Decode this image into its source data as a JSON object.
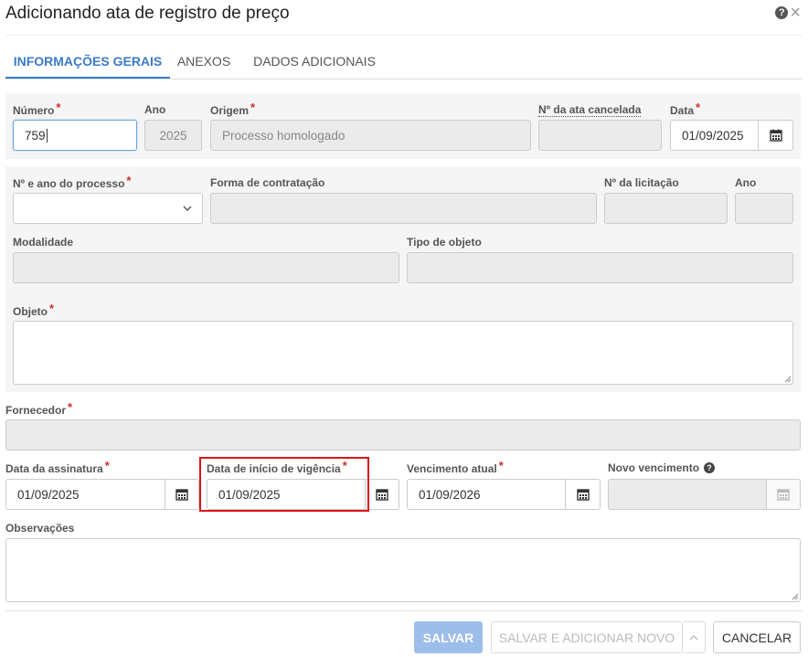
{
  "dialog": {
    "title": "Adicionando ata de registro de preço"
  },
  "tabs": [
    {
      "label": "INFORMAÇÕES GERAIS",
      "active": true
    },
    {
      "label": "ANEXOS",
      "active": false
    },
    {
      "label": "DADOS ADICIONAIS",
      "active": false
    }
  ],
  "required_mark": "*",
  "section1": {
    "numero": {
      "label": "Número",
      "value": "759"
    },
    "ano": {
      "label": "Ano",
      "value": "2025"
    },
    "origem": {
      "label": "Origem",
      "value": "Processo homologado"
    },
    "ata_cancelada": {
      "label": "Nº da ata cancelada",
      "value": ""
    },
    "data": {
      "label": "Data",
      "value": "01/09/2025"
    }
  },
  "section2": {
    "processo": {
      "label": "Nº e ano do processo",
      "value": ""
    },
    "forma": {
      "label": "Forma de contratação",
      "value": ""
    },
    "licitacao": {
      "label": "Nº da licitação",
      "value": ""
    },
    "ano": {
      "label": "Ano",
      "value": ""
    },
    "modalidade": {
      "label": "Modalidade",
      "value": ""
    },
    "tipo_objeto": {
      "label": "Tipo de objeto",
      "value": ""
    },
    "objeto": {
      "label": "Objeto",
      "value": ""
    }
  },
  "fornecedor": {
    "label": "Fornecedor",
    "value": ""
  },
  "dates": {
    "assinatura": {
      "label": "Data da assinatura",
      "value": "01/09/2025"
    },
    "inicio_vigencia": {
      "label": "Data de início de vigência",
      "value": "01/09/2025"
    },
    "vencimento_atual": {
      "label": "Vencimento atual",
      "value": "01/09/2026"
    },
    "novo_vencimento": {
      "label": "Novo vencimento",
      "value": ""
    }
  },
  "observacoes": {
    "label": "Observações",
    "value": ""
  },
  "buttons": {
    "save": "SALVAR",
    "save_new": "SALVAR E ADICIONAR NOVO",
    "cancel": "CANCELAR"
  },
  "colors": {
    "accent": "#3a7bc8",
    "required": "#c9302c",
    "highlight": "#d9141c",
    "save_button": "#9dbdea"
  },
  "icons": {
    "help": "question-circle",
    "close": "times",
    "calendar": "calendar",
    "dropdown": "chevron-down"
  }
}
